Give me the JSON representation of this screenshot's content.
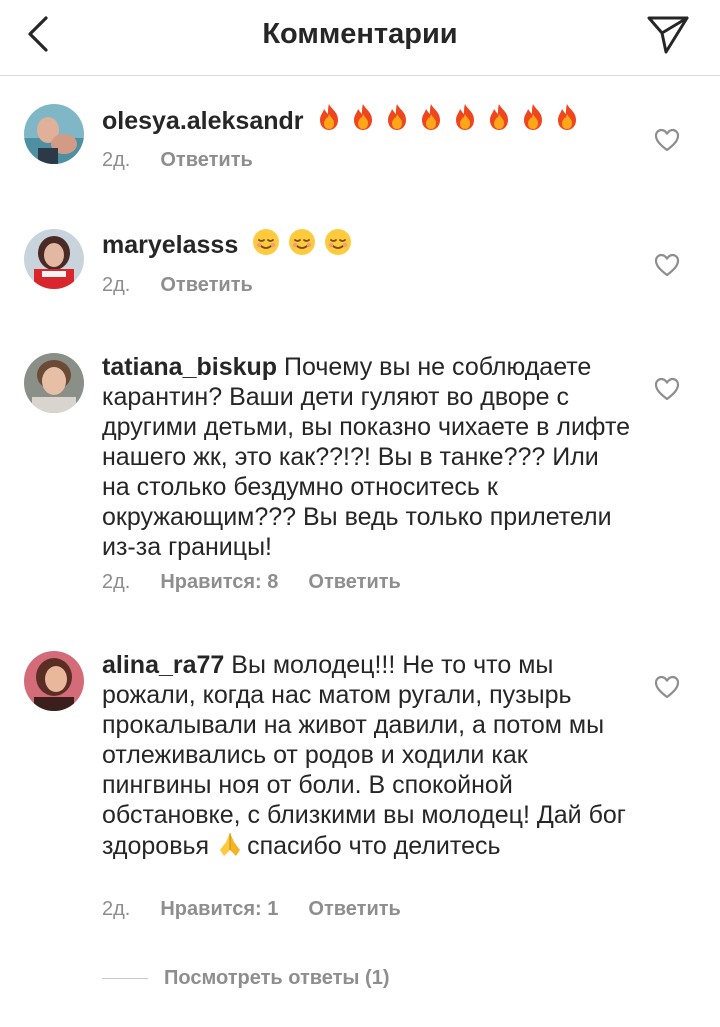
{
  "header": {
    "title": "Комментарии"
  },
  "comments": [
    {
      "username": "olesya.aleksandr",
      "text": "",
      "emoji": [
        "fire-emoji",
        "fire-emoji",
        "fire-emoji",
        "fire-emoji",
        "fire-emoji",
        "fire-emoji",
        "fire-emoji",
        "fire-emoji"
      ],
      "time": "2д.",
      "likes": "",
      "reply_label": "Ответить"
    },
    {
      "username": "maryelasss",
      "text": "",
      "emoji": [
        "relieved-face-emoji",
        "relieved-face-emoji",
        "relieved-face-emoji"
      ],
      "time": "2д.",
      "likes": "",
      "reply_label": "Ответить"
    },
    {
      "username": "tatiana_biskup",
      "text": "Почему вы не соблюдаете карантин? Ваши дети гуляют во дворе с другими детьми, вы показно чихаете в лифте нашего жк, это как??!?! Вы в танке??? Или на столько бездумно относитесь к окружающим??? Вы ведь только прилетели из-за границы!",
      "time": "2д.",
      "likes": "Нравится: 8",
      "reply_label": "Ответить"
    },
    {
      "username": "alina_ra77",
      "text_before": "Вы молодец!!! Не то что мы рожали, когда нас матом ругали, пузырь прокалывали на живот давили, а потом мы отлеживались от родов и ходили как пингвины ноя от боли. В спокойной обстановке,  с близкими вы молодец! Дай бог здоровья",
      "emoji": "folded-hands-emoji",
      "text_after": "спасибо что делитесь",
      "time": "2д.",
      "likes": "Нравится: 1",
      "reply_label": "Ответить"
    }
  ],
  "view_replies": "Посмотреть ответы (1)",
  "icons": {
    "back": "chevron-left-icon",
    "send": "paper-plane-icon",
    "like": "heart-outline-icon"
  },
  "colors": {
    "text": "#262626",
    "secondary": "#8e8e8e",
    "divider": "#dbdbdb"
  }
}
